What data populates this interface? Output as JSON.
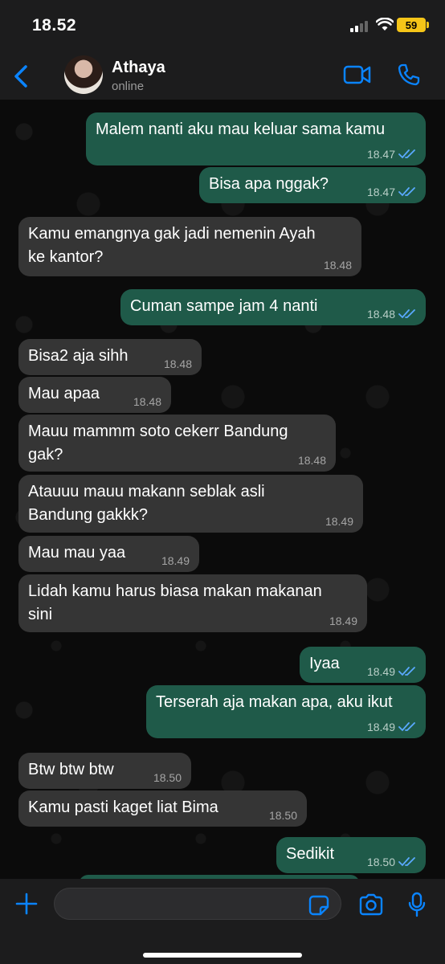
{
  "status_bar": {
    "time": "18.52",
    "battery": "59"
  },
  "header": {
    "contact_name": "Athaya",
    "contact_status": "online"
  },
  "colors": {
    "accent": "#0a84ff",
    "outgoing_bubble": "#1f5a49",
    "incoming_bubble": "#353535",
    "read_ticks": "#5aa9ff",
    "battery": "#f5c518"
  },
  "icons": [
    "back-chevron-icon",
    "video-call-icon",
    "phone-call-icon",
    "plus-icon",
    "sticker-icon",
    "camera-icon",
    "microphone-icon",
    "read-receipt-icon"
  ],
  "messages": [
    {
      "direction": "out",
      "text": "Malem nanti aku mau keluar sama kamu",
      "time": "18.47",
      "read": true
    },
    {
      "direction": "out",
      "text": "Bisa apa nggak?",
      "time": "18.47",
      "read": true
    },
    {
      "direction": "in",
      "text": "Kamu emangnya gak jadi nemenin Ayah\nke kantor?",
      "time": "18.48"
    },
    {
      "direction": "out",
      "text": "Cuman sampe jam 4 nanti",
      "time": "18.48",
      "read": true
    },
    {
      "direction": "in",
      "text": "Bisa2 aja sihh",
      "time": "18.48"
    },
    {
      "direction": "in",
      "text": "Mau apaa",
      "time": "18.48"
    },
    {
      "direction": "in",
      "text": "Mauu mammm soto cekerr Bandung\ngak?",
      "time": "18.48"
    },
    {
      "direction": "in",
      "text": "Atauuu mauu makann seblak asli\nBandung gakkk?",
      "time": "18.49"
    },
    {
      "direction": "in",
      "text": "Mau mau yaa",
      "time": "18.49"
    },
    {
      "direction": "in",
      "text": "Lidah kamu harus biasa makan makanan\nsini",
      "time": "18.49"
    },
    {
      "direction": "out",
      "text": "Iyaa",
      "time": "18.49",
      "read": true
    },
    {
      "direction": "out",
      "text": "Terserah aja makan apa, aku ikut",
      "time": "18.49",
      "read": true
    },
    {
      "direction": "in",
      "text": "Btw btw btw",
      "time": "18.50"
    },
    {
      "direction": "in",
      "text": "Kamu pasti kaget liat Bima",
      "time": "18.50"
    },
    {
      "direction": "out",
      "text": "Sedikit",
      "time": "18.50",
      "read": true
    }
  ],
  "input": {
    "value": "",
    "placeholder": ""
  }
}
